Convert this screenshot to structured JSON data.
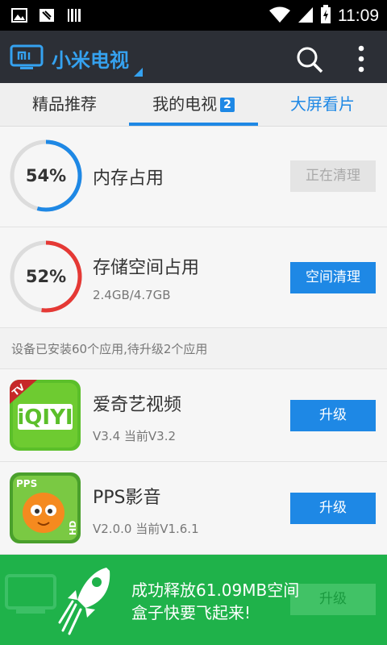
{
  "status_bar": {
    "time": "11:09"
  },
  "app_bar": {
    "title": "小米电视"
  },
  "tabs": [
    {
      "label": "精品推荐"
    },
    {
      "label": "我的电视",
      "badge": "2"
    },
    {
      "label": "大屏看片"
    }
  ],
  "memory": {
    "percent_text": "54%",
    "percent": 54,
    "title": "内存占用",
    "button": "正在清理",
    "ring_color": "#1e88e5"
  },
  "storage": {
    "percent_text": "52%",
    "percent": 52,
    "title": "存储空间占用",
    "usage": "2.4GB/4.7GB",
    "button": "空间清理",
    "ring_color": "#e53935"
  },
  "install_info": "设备已安装60个应用,待升级2个应用",
  "apps": [
    {
      "name": "爱奇艺视频",
      "version": "V3.4 当前V3.2",
      "button": "升级"
    },
    {
      "name": "PPS影音",
      "version": "V2.0.0 当前V1.6.1",
      "button": "升级"
    }
  ],
  "toast": {
    "line1": "成功释放61.09MB空间",
    "line2": "盒子快要飞起来!",
    "hidden_button": "升级"
  },
  "colors": {
    "accent": "#1e88e5",
    "toast_green": "#1fb24a",
    "title_bar": "#2c2f36"
  }
}
